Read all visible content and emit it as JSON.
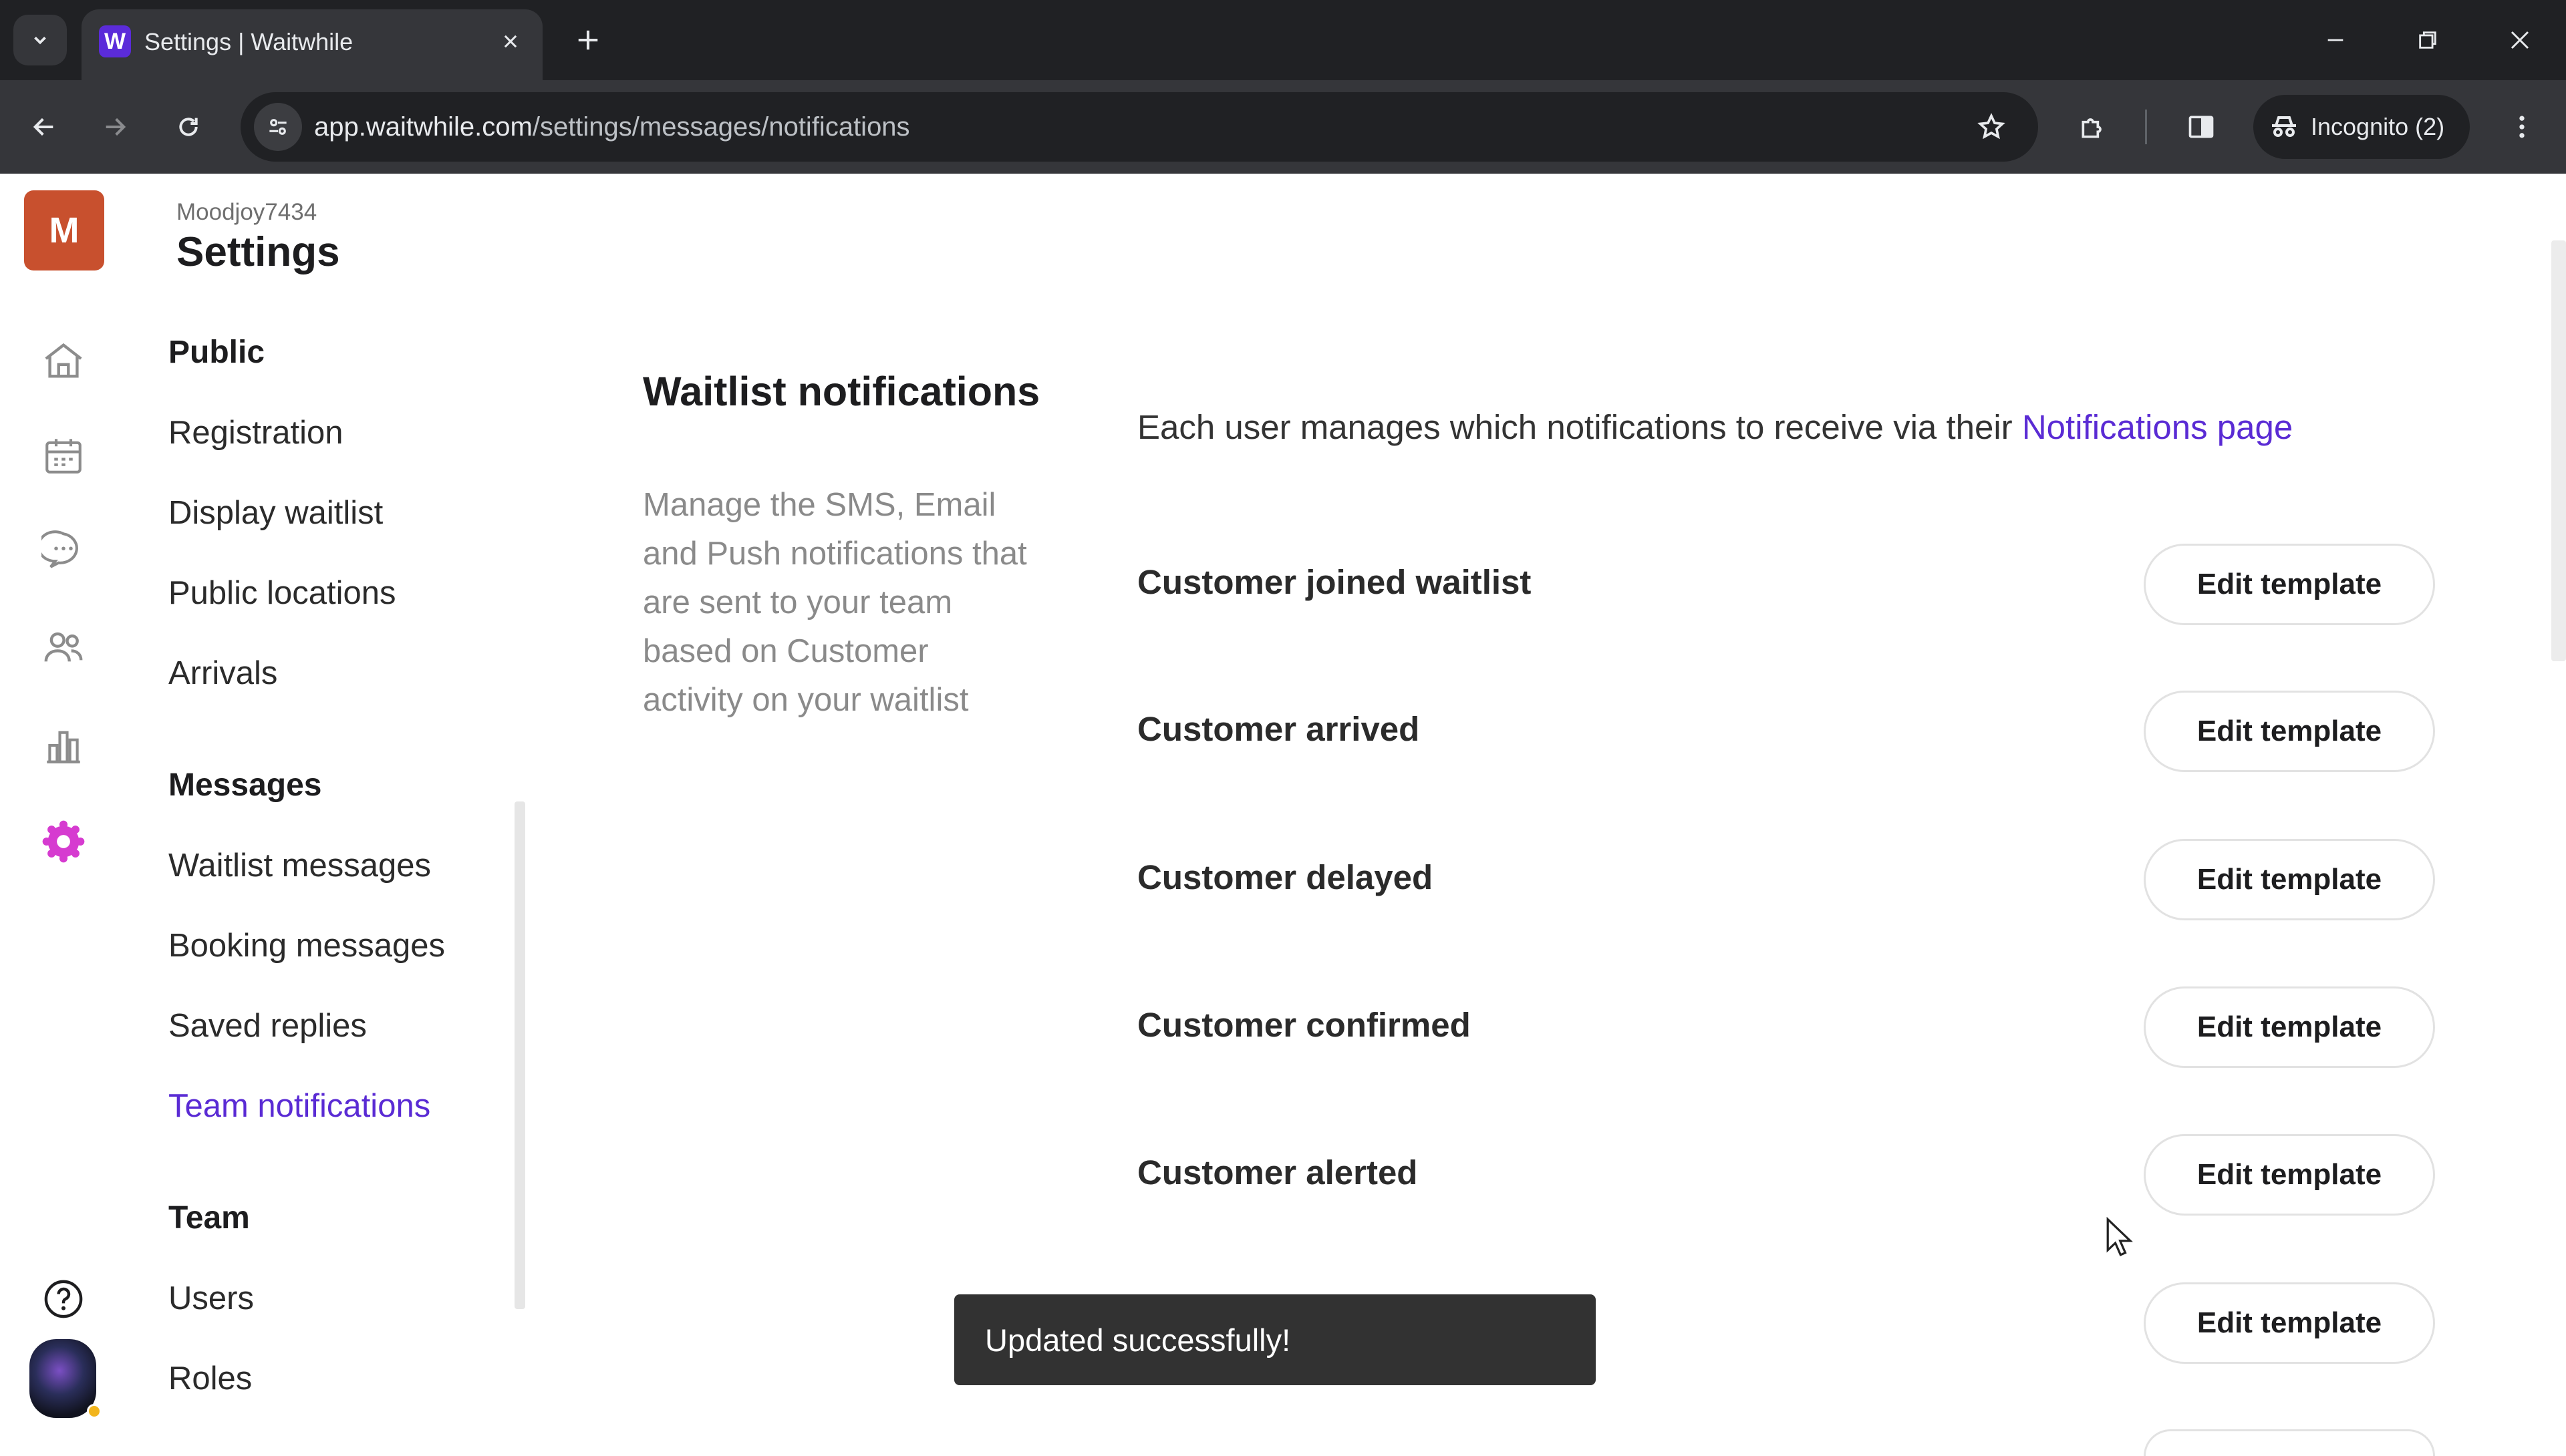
{
  "browser": {
    "tab_title": "Settings | Waitwhile",
    "favicon_letter": "W",
    "url_host": "app.waitwhile.com",
    "url_path": "/settings/messages/notifications",
    "incognito_label": "Incognito (2)"
  },
  "app": {
    "org_initial": "M",
    "org_name": "Moodjoy7434",
    "page_title": "Settings",
    "rail_icons": [
      "home-icon",
      "calendar-icon",
      "messages-icon",
      "customers-icon",
      "analytics-icon",
      "settings-gear-icon",
      "help-icon"
    ]
  },
  "subnav": {
    "public": {
      "heading": "Public",
      "items": [
        "Registration",
        "Display waitlist",
        "Public locations",
        "Arrivals"
      ]
    },
    "messages": {
      "heading": "Messages",
      "items": [
        "Waitlist messages",
        "Booking messages",
        "Saved replies",
        "Team notifications"
      ]
    },
    "team": {
      "heading": "Team",
      "items": [
        "Users",
        "Roles"
      ]
    },
    "active_item": "Team notifications"
  },
  "main": {
    "section_title": "Waitlist notifications",
    "section_description": "Manage the SMS, Email and Push notifications that are sent to your team based on Customer activity on your waitlist",
    "intro_text": "Each user manages which notifications to receive via their ",
    "intro_link": "Notifications page",
    "rows": [
      {
        "label": "Customer joined waitlist",
        "button": "Edit template"
      },
      {
        "label": "Customer arrived",
        "button": "Edit template"
      },
      {
        "label": "Customer delayed",
        "button": "Edit template"
      },
      {
        "label": "Customer confirmed",
        "button": "Edit template"
      },
      {
        "label": "Customer alerted",
        "button": "Edit template"
      },
      {
        "label": "",
        "button": "Edit template"
      }
    ]
  },
  "toast": {
    "message": "Updated successfully!"
  },
  "colors": {
    "accent": "#5a2bd4",
    "org_badge": "#c8502e",
    "settings_icon": "#d63bd0"
  }
}
